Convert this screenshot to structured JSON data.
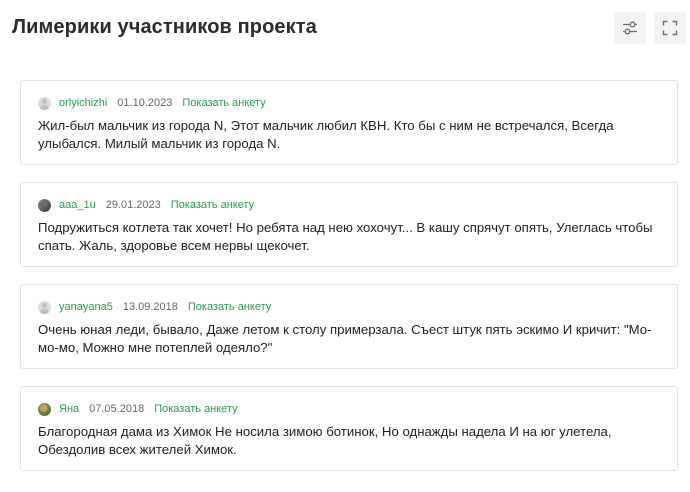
{
  "header": {
    "title": "Лимерики участников проекта",
    "icons": {
      "filter": "sliders-icon",
      "expand": "fullscreen-icon"
    }
  },
  "colors": {
    "accent": "#2a9a53",
    "border": "#e2e2e2",
    "text": "#222222",
    "muted": "#666666"
  },
  "limericks": [
    {
      "username": "orlyichizhi",
      "date": "01.10.2023",
      "link_label": "Показать анкету",
      "avatar": "default",
      "text": "Жил-был мальчик из города N, Этот мальчик любил КВН. Кто бы с ним не встречался, Всегда улыбался. Милый мальчик из города N."
    },
    {
      "username": "aaa_1u",
      "date": "29.01.2023",
      "link_label": "Показать анкету",
      "avatar": "photo1",
      "text": "Подружиться котлета так хочет! Но ребята над нею хохочут... В кашу спрячут опять, Улеглась чтобы спать. Жаль, здоровье всем нервы щекочет."
    },
    {
      "username": "yanayana5",
      "date": "13.09.2018",
      "link_label": "Показать анкету",
      "avatar": "default",
      "text": "Очень юная леди, бывало, Даже летом к столу примерзала. Съест штук пять эскимо И кричит: \"Мо-мо-мо, Можно мне потеплей одеяло?\""
    },
    {
      "username": "Яна",
      "date": "07.05.2018",
      "link_label": "Показать анкету",
      "avatar": "photo2",
      "text": "Благородная дама из Химок Не носила зимою ботинок, Но однажды надела И на юг улетела, Обездолив всех жителей Химок."
    }
  ]
}
